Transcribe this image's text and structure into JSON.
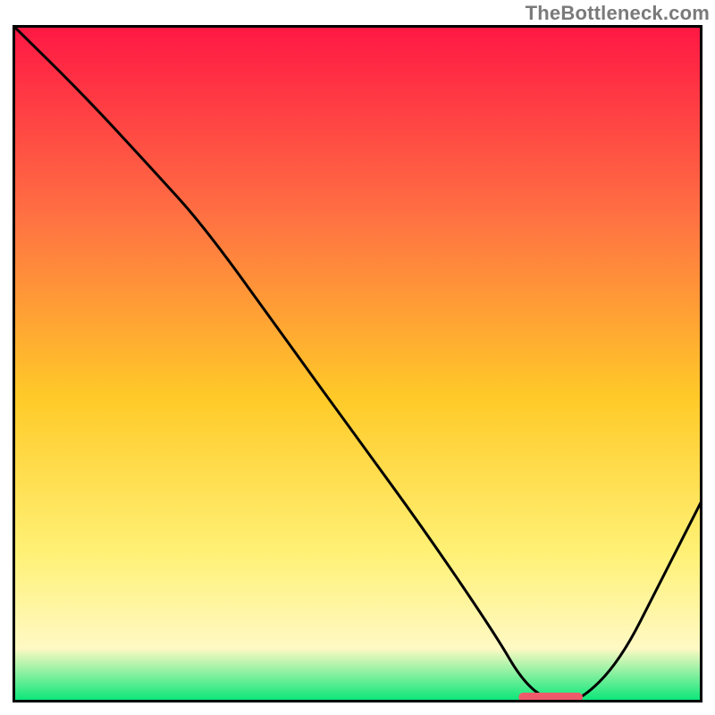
{
  "watermark": "TheBottleneck.com",
  "colors": {
    "gradient_top": "#ff1744",
    "gradient_mid1": "#ff7043",
    "gradient_mid2": "#ffca28",
    "gradient_mid3": "#fff176",
    "gradient_mid4": "#fff9c4",
    "gradient_bottom": "#00e676",
    "plot_border": "#000000",
    "curve": "#000000",
    "marker": "#ef5a6b"
  },
  "chart_data": {
    "type": "line",
    "title": "",
    "xlabel": "",
    "ylabel": "",
    "xlim": [
      0,
      100
    ],
    "ylim": [
      0,
      100
    ],
    "x": [
      0,
      10,
      20,
      28,
      40,
      50,
      60,
      70,
      74,
      78,
      82,
      88,
      94,
      100
    ],
    "values": [
      100,
      90,
      79,
      70,
      53,
      39,
      25,
      10,
      3,
      0,
      0,
      6,
      18,
      30
    ],
    "marker": {
      "x_start": 74,
      "x_end": 82,
      "y": 0
    },
    "description": "Single dark curve on a vertical rainbow gradient background. Curve descends steeply from top-left, reaches zero near x≈78, then rises toward the right edge. A short red marker segment sits on the x-axis at the minimum."
  }
}
